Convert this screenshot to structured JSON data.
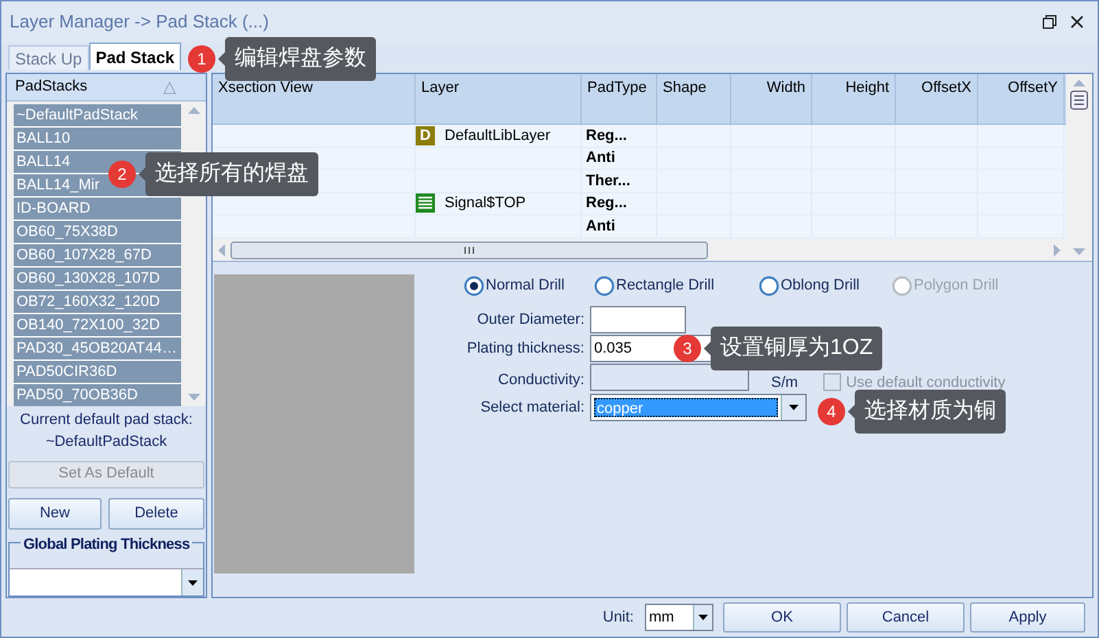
{
  "window": {
    "title": "Layer Manager -> Pad Stack (...)"
  },
  "tabs": [
    {
      "label": "Stack Up",
      "selected": false
    },
    {
      "label": "Pad Stack",
      "selected": true
    }
  ],
  "padstacks": {
    "header": "PadStacks",
    "sort_glyph": "△",
    "items": [
      {
        "label": "~DefaultPadStack",
        "selected": true
      },
      {
        "label": "BALL10",
        "selected": true
      },
      {
        "label": "BALL14",
        "selected": true
      },
      {
        "label": "BALL14_Mir",
        "selected": true
      },
      {
        "label": "ID-BOARD",
        "selected": true
      },
      {
        "label": "OB60_75X38D",
        "selected": true
      },
      {
        "label": "OB60_107X28_67D",
        "selected": true
      },
      {
        "label": "OB60_130X28_107D",
        "selected": true
      },
      {
        "label": "OB72_160X32_120D",
        "selected": true
      },
      {
        "label": "OB140_72X100_32D",
        "selected": true
      },
      {
        "label": "PAD30_45OB20AT44…",
        "selected": true
      },
      {
        "label": "PAD50CIR36D",
        "selected": true
      },
      {
        "label": "PAD50_70OB36D",
        "selected": true
      }
    ],
    "current_label": "Current default pad stack:",
    "current_value": "~DefaultPadStack",
    "set_default_button": {
      "label": "Set As Default",
      "disabled": true
    },
    "new_button": "New",
    "delete_button": "Delete",
    "plating_group": "Global Plating Thickness"
  },
  "grid": {
    "columns": [
      "Xsection View",
      "Layer",
      "PadType",
      "Shape",
      "Width",
      "Height",
      "OffsetX",
      "OffsetY"
    ],
    "rows": [
      {
        "layer": "DefaultLibLayer",
        "kind": "default",
        "badge": "D",
        "padtype": "Reg..."
      },
      {
        "padtype": "Anti"
      },
      {
        "padtype": "Ther..."
      },
      {
        "layer": "Signal$TOP",
        "kind": "signal",
        "padtype": "Reg..."
      },
      {
        "padtype": "Anti"
      }
    ]
  },
  "drill_types": [
    {
      "label": "Normal Drill",
      "selected": true,
      "disabled": false
    },
    {
      "label": "Rectangle Drill",
      "selected": false,
      "disabled": false
    },
    {
      "label": "Oblong Drill",
      "selected": false,
      "disabled": false
    },
    {
      "label": "Polygon Drill",
      "selected": false,
      "disabled": true
    }
  ],
  "fields": {
    "outer_diameter": {
      "label": "Outer Diameter:"
    },
    "plating_thickness": {
      "label": "Plating thickness:",
      "value": "0.035"
    },
    "conductivity": {
      "label": "Conductivity:",
      "unit": "S/m",
      "disabled": true
    },
    "use_default_conductivity": {
      "label": "Use default conductivity",
      "checked": false,
      "disabled": true
    },
    "material": {
      "label": "Select material:",
      "value": "copper"
    }
  },
  "footer": {
    "unit_label": "Unit:",
    "unit_value": "mm",
    "buttons": [
      "OK",
      "Cancel",
      "Apply"
    ]
  },
  "callouts": [
    {
      "number": "1",
      "text": "编辑焊盘参数"
    },
    {
      "number": "2",
      "text": "选择所有的焊盘"
    },
    {
      "number": "3",
      "text": "设置铜厚为1OZ"
    },
    {
      "number": "4",
      "text": "选择材质为铜"
    }
  ]
}
